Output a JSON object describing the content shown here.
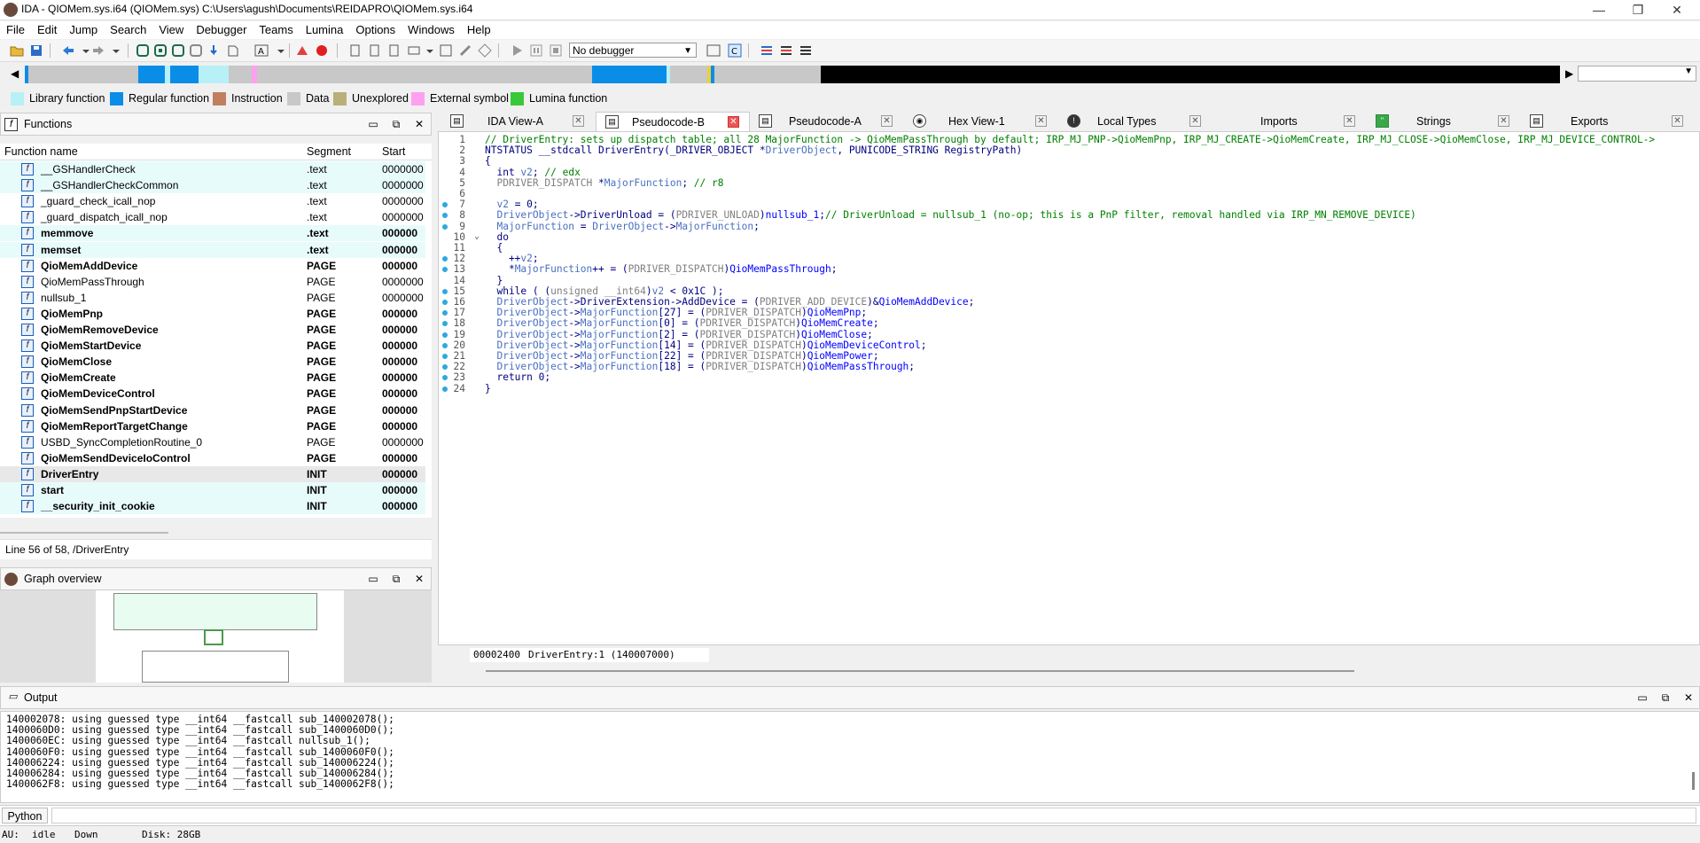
{
  "window": {
    "title": "IDA - QIOMem.sys.i64 (QIOMem.sys) C:\\Users\\agush\\Documents\\REIDAPRO\\QIOMem.sys.i64",
    "minimize": "—",
    "maximize": "❐",
    "close": "✕"
  },
  "menu": [
    "File",
    "Edit",
    "Jump",
    "Search",
    "View",
    "Debugger",
    "Teams",
    "Lumina",
    "Options",
    "Windows",
    "Help"
  ],
  "toolbar": {
    "debugger_select": "No debugger"
  },
  "legend": [
    {
      "label": "Library function",
      "color": "#b8f0f8"
    },
    {
      "label": "Regular function",
      "color": "#0a8de6"
    },
    {
      "label": "Instruction",
      "color": "#c08060"
    },
    {
      "label": "Data",
      "color": "#c8c8c8"
    },
    {
      "label": "Unexplored",
      "color": "#b8b078"
    },
    {
      "label": "External symbol",
      "color": "#ff9ff0"
    },
    {
      "label": "Lumina function",
      "color": "#38c838"
    }
  ],
  "functions_panel": {
    "title": "Functions",
    "columns": [
      "Function name",
      "Segment",
      "Start"
    ],
    "rows": [
      {
        "name": "__GSHandlerCheck",
        "segment": ".text",
        "start": "0000000",
        "bold": false,
        "lib": true
      },
      {
        "name": "__GSHandlerCheckCommon",
        "segment": ".text",
        "start": "0000000",
        "bold": false,
        "lib": true
      },
      {
        "name": "_guard_check_icall_nop",
        "segment": ".text",
        "start": "0000000",
        "bold": false,
        "lib": false
      },
      {
        "name": "_guard_dispatch_icall_nop",
        "segment": ".text",
        "start": "0000000",
        "bold": false,
        "lib": false
      },
      {
        "name": "memmove",
        "segment": ".text",
        "start": "000000",
        "bold": true,
        "lib": true
      },
      {
        "name": "memset",
        "segment": ".text",
        "start": "000000",
        "bold": true,
        "lib": true
      },
      {
        "name": "QioMemAddDevice",
        "segment": "PAGE",
        "start": "000000",
        "bold": true,
        "lib": false
      },
      {
        "name": "QioMemPassThrough",
        "segment": "PAGE",
        "start": "0000000",
        "bold": false,
        "lib": false
      },
      {
        "name": "nullsub_1",
        "segment": "PAGE",
        "start": "0000000",
        "bold": false,
        "lib": false
      },
      {
        "name": "QioMemPnp",
        "segment": "PAGE",
        "start": "000000",
        "bold": true,
        "lib": false
      },
      {
        "name": "QioMemRemoveDevice",
        "segment": "PAGE",
        "start": "000000",
        "bold": true,
        "lib": false
      },
      {
        "name": "QioMemStartDevice",
        "segment": "PAGE",
        "start": "000000",
        "bold": true,
        "lib": false
      },
      {
        "name": "QioMemClose",
        "segment": "PAGE",
        "start": "000000",
        "bold": true,
        "lib": false
      },
      {
        "name": "QioMemCreate",
        "segment": "PAGE",
        "start": "000000",
        "bold": true,
        "lib": false
      },
      {
        "name": "QioMemDeviceControl",
        "segment": "PAGE",
        "start": "000000",
        "bold": true,
        "lib": false
      },
      {
        "name": "QioMemSendPnpStartDevice",
        "segment": "PAGE",
        "start": "000000",
        "bold": true,
        "lib": false
      },
      {
        "name": "QioMemReportTargetChange",
        "segment": "PAGE",
        "start": "000000",
        "bold": true,
        "lib": false
      },
      {
        "name": "USBD_SyncCompletionRoutine_0",
        "segment": "PAGE",
        "start": "0000000",
        "bold": false,
        "lib": false
      },
      {
        "name": "QioMemSendDeviceIoControl",
        "segment": "PAGE",
        "start": "000000",
        "bold": true,
        "lib": false
      },
      {
        "name": "DriverEntry",
        "segment": "INIT",
        "start": "000000",
        "bold": true,
        "lib": false,
        "selected": true
      },
      {
        "name": "start",
        "segment": "INIT",
        "start": "000000",
        "bold": true,
        "lib": true
      },
      {
        "name": "__security_init_cookie",
        "segment": "INIT",
        "start": "000000",
        "bold": true,
        "lib": true
      }
    ],
    "status": "Line 56 of 58, /DriverEntry"
  },
  "graph_panel": {
    "title": "Graph overview"
  },
  "tabs": [
    {
      "label": "IDA View-A",
      "active": false
    },
    {
      "label": "Pseudocode-B",
      "active": true
    },
    {
      "label": "Pseudocode-A",
      "active": false
    },
    {
      "label": "Hex View-1",
      "active": false
    },
    {
      "label": "Local Types",
      "active": false
    },
    {
      "label": "Imports",
      "active": false
    },
    {
      "label": "Strings",
      "active": false
    },
    {
      "label": "Exports",
      "active": false
    }
  ],
  "code": {
    "lines": [
      {
        "n": "1",
        "dot": false,
        "text": "// DriverEntry: sets up dispatch table; all 28 MajorFunction -> QioMemPassThrough by default; IRP_MJ_PNP->QioMemPnp, IRP_MJ_CREATE->QioMemCreate, IRP_MJ_CLOSE->QioMemClose, IRP_MJ_DEVICE_CONTROL->"
      },
      {
        "n": "2",
        "dot": false,
        "text": "NTSTATUS __stdcall DriverEntry(_DRIVER_OBJECT *DriverObject, PUNICODE_STRING RegistryPath)"
      },
      {
        "n": "3",
        "dot": false,
        "text": "{"
      },
      {
        "n": "4",
        "dot": false,
        "text": "  int v2; // edx"
      },
      {
        "n": "5",
        "dot": false,
        "text": "  PDRIVER_DISPATCH *MajorFunction; // r8"
      },
      {
        "n": "6",
        "dot": false,
        "text": ""
      },
      {
        "n": "7",
        "dot": true,
        "text": "  v2 = 0;"
      },
      {
        "n": "8",
        "dot": true,
        "text": "  DriverObject->DriverUnload = (PDRIVER_UNLOAD)nullsub_1;// DriverUnload = nullsub_1 (no-op; this is a PnP filter, removal handled via IRP_MN_REMOVE_DEVICE)"
      },
      {
        "n": "9",
        "dot": true,
        "text": "  MajorFunction = DriverObject->MajorFunction;"
      },
      {
        "n": "10",
        "dot": false,
        "text": "  do",
        "fold": true
      },
      {
        "n": "11",
        "dot": false,
        "text": "  {"
      },
      {
        "n": "12",
        "dot": true,
        "text": "    ++v2;"
      },
      {
        "n": "13",
        "dot": true,
        "text": "    *MajorFunction++ = (PDRIVER_DISPATCH)QioMemPassThrough;"
      },
      {
        "n": "14",
        "dot": false,
        "text": "  }"
      },
      {
        "n": "15",
        "dot": true,
        "text": "  while ( (unsigned __int64)v2 < 0x1C );"
      },
      {
        "n": "16",
        "dot": true,
        "text": "  DriverObject->DriverExtension->AddDevice = (PDRIVER_ADD_DEVICE)&QioMemAddDevice;"
      },
      {
        "n": "17",
        "dot": true,
        "text": "  DriverObject->MajorFunction[27] = (PDRIVER_DISPATCH)QioMemPnp;"
      },
      {
        "n": "18",
        "dot": true,
        "text": "  DriverObject->MajorFunction[0] = (PDRIVER_DISPATCH)QioMemCreate;"
      },
      {
        "n": "19",
        "dot": true,
        "text": "  DriverObject->MajorFunction[2] = (PDRIVER_DISPATCH)QioMemClose;"
      },
      {
        "n": "20",
        "dot": true,
        "text": "  DriverObject->MajorFunction[14] = (PDRIVER_DISPATCH)QioMemDeviceControl;"
      },
      {
        "n": "21",
        "dot": true,
        "text": "  DriverObject->MajorFunction[22] = (PDRIVER_DISPATCH)QioMemPower;"
      },
      {
        "n": "22",
        "dot": true,
        "text": "  DriverObject->MajorFunction[18] = (PDRIVER_DISPATCH)QioMemPassThrough;"
      },
      {
        "n": "23",
        "dot": true,
        "text": "  return 0;"
      },
      {
        "n": "24",
        "dot": true,
        "text": "}"
      }
    ],
    "status_addr": "00002400",
    "status_loc": "DriverEntry:1 (140007000)"
  },
  "output": {
    "title": "Output",
    "lines": [
      "140002078: using guessed type __int64 __fastcall sub_140002078();",
      "1400060D0: using guessed type __int64 __fastcall sub_1400060D0();",
      "1400060EC: using guessed type __int64 __fastcall nullsub_1();",
      "1400060F0: using guessed type __int64 __fastcall sub_1400060F0();",
      "140006224: using guessed type __int64 __fastcall sub_140006224();",
      "140006284: using guessed type __int64 __fastcall sub_140006284();",
      "1400062F8: using guessed type __int64 __fastcall sub_1400062F8();"
    ],
    "python_label": "Python"
  },
  "status": {
    "au": "AU:",
    "state": "idle",
    "direction": "Down",
    "disk": "Disk: 28GB"
  }
}
